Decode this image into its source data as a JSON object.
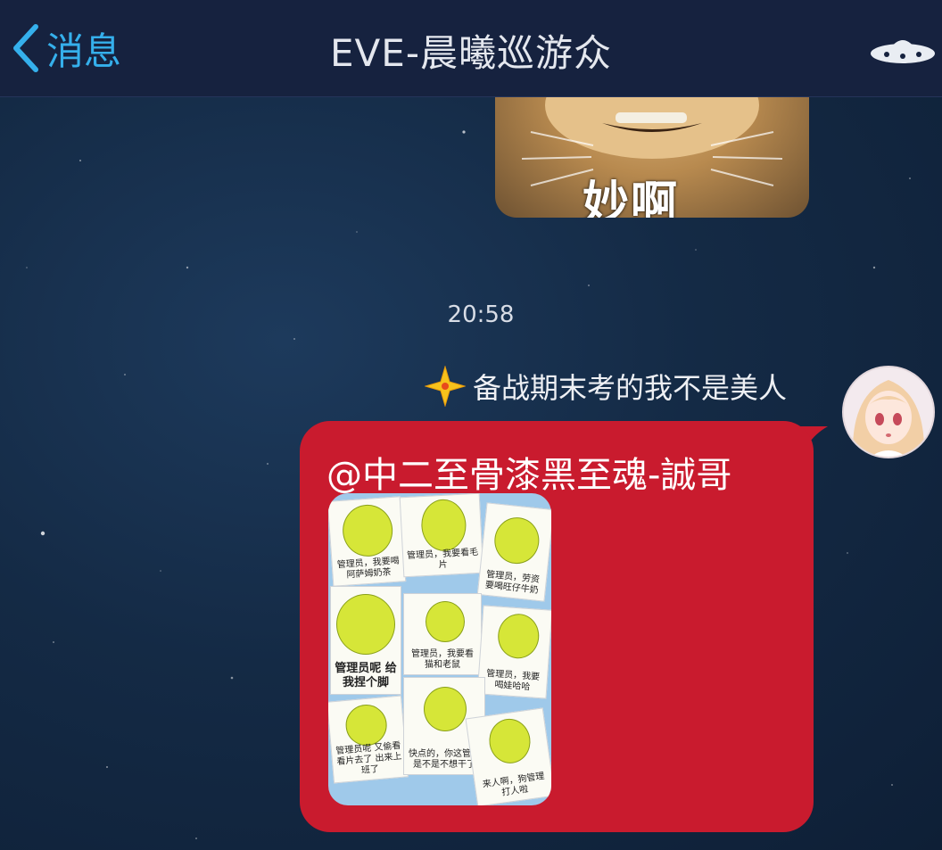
{
  "header": {
    "back_label": "消息",
    "title": "EVE-晨曦巡游众"
  },
  "previous_message": {
    "image_caption": "妙啊"
  },
  "timestamp": "20:58",
  "message": {
    "sender_name": "备战期末考的我不是美人",
    "mention": "@中二至骨漆黑至魂-誠哥",
    "bubble_color": "#c91b2e",
    "sticker_captions": [
      "管理员，我要喝阿萨姆奶茶",
      "管理员，我要看毛片",
      "管理员，劳资要喝旺仔牛奶",
      "管理员呢 给我捏个脚",
      "管理员，我要看猫和老鼠",
      "管理员，我要喝娃哈哈",
      "管理员呢 又偷看看片去了 出来上班了",
      "快点的，你这管理是不是不想干了",
      "来人啊，狗管理打人啦"
    ]
  },
  "colors": {
    "header_bg": "#16223f",
    "accent": "#35b0ec",
    "background": "#142a45"
  }
}
